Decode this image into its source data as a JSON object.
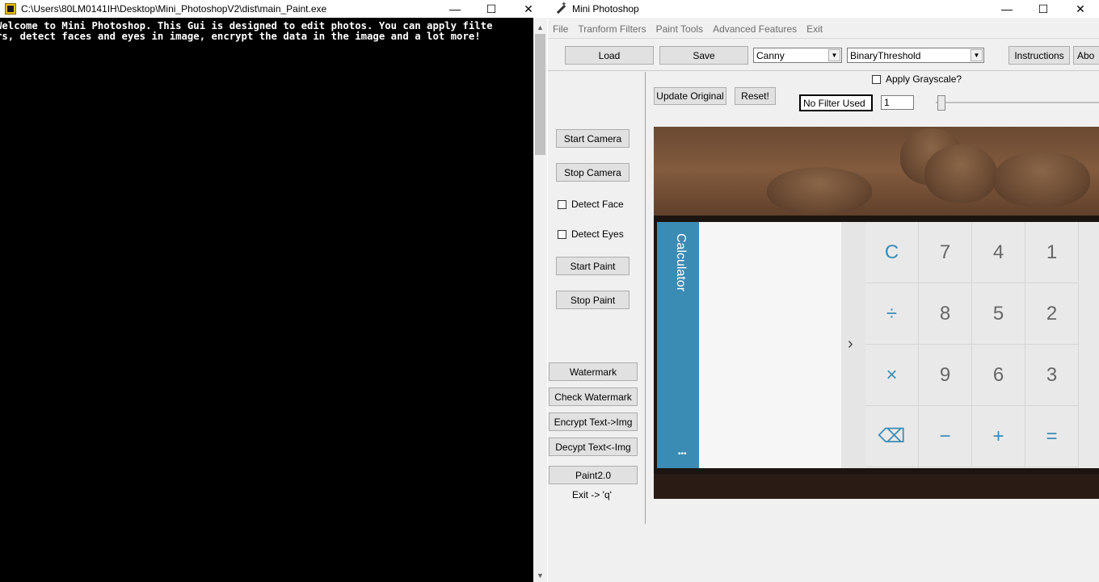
{
  "console": {
    "title": "C:\\Users\\80LM0141IH\\Desktop\\Mini_PhotoshopV2\\dist\\main_Paint.exe",
    "line1": "Welcome to Mini Photoshop. This Gui is designed to edit photos. You can apply filte",
    "line2": "rs, detect faces and eyes in image, encrypt the data in the image and a lot more!",
    "controls": {
      "minimize": "—",
      "maximize": "☐",
      "close": "✕"
    }
  },
  "app": {
    "title": "Mini Photoshop",
    "controls": {
      "minimize": "—",
      "maximize": "☐",
      "close": "✕"
    },
    "menu": [
      "File",
      "Tranform Filters",
      "Paint Tools",
      "Advanced Features",
      "Exit"
    ],
    "toolbar": {
      "load": "Load",
      "save": "Save",
      "filter_combo": "Canny",
      "threshold_combo": "BinaryThreshold",
      "instructions": "Instructions",
      "about": "Abo"
    },
    "controls_row": {
      "apply_grayscale": "Apply Grayscale?",
      "update_original": "Update Original",
      "reset": "Reset!",
      "filter_status": "No Filter Used",
      "value_entry": "1"
    },
    "sidebar": {
      "start_camera": "Start Camera",
      "stop_camera": "Stop Camera",
      "detect_face": "Detect Face",
      "detect_eyes": "Detect Eyes",
      "start_paint": "Start Paint",
      "stop_paint": "Stop Paint",
      "watermark": "Watermark",
      "check_watermark": "Check Watermark",
      "encrypt": "Encrypt Text->Img",
      "decrypt": "Decypt Text<-Img",
      "paint2": "Paint2.0",
      "exit_hint": "Exit -> 'q'"
    },
    "camera": {
      "calc_label": "Calculator",
      "chevron": "›",
      "dots": "•••",
      "keys": [
        "C",
        "7",
        "4",
        "1",
        "÷",
        "8",
        "5",
        "2",
        "×",
        "9",
        "6",
        "3",
        "⌫",
        "−",
        "+",
        "="
      ]
    }
  }
}
